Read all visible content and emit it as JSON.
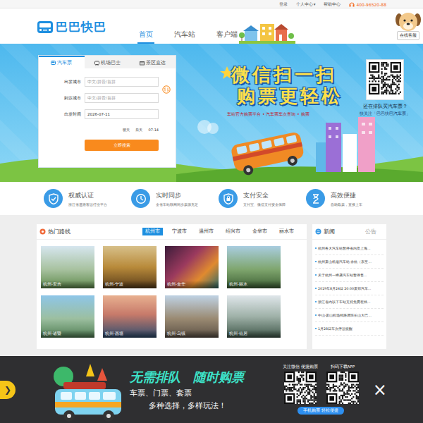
{
  "topbar": {
    "links": [
      {
        "label": "登录"
      },
      {
        "label": "个人中心",
        "caret": "▾"
      },
      {
        "label": "帮助中心"
      }
    ],
    "phone": "400-96520-88"
  },
  "header": {
    "logo": "巴巴快巴",
    "nav": [
      {
        "label": "首页",
        "selected": true
      },
      {
        "label": "汽车站",
        "selected": false
      },
      {
        "label": "客户端",
        "selected": false
      }
    ],
    "service": "在线客服"
  },
  "search": {
    "tabs": [
      {
        "label": "汽车票",
        "selected": true
      },
      {
        "label": "机场巴士",
        "selected": false
      },
      {
        "label": "景区直达",
        "selected": false
      }
    ],
    "fields": [
      {
        "label": "出发城市",
        "placeholder": "中文/拼音/首拼"
      },
      {
        "label": "到达城市",
        "placeholder": "中文/拼音/首拼"
      },
      {
        "label": "出发时间",
        "value": "2026-07-11"
      }
    ],
    "quick_dates": [
      "明天",
      "后天",
      "07-14"
    ],
    "button": "立即搜索"
  },
  "banner": {
    "headline": [
      "微信扫一扫",
      "购票更轻松"
    ],
    "subtitle": "车站官方购票平台 • 汽车票车次查询 • 购票",
    "qr_caption": "还在排队买汽车票？",
    "qr_follow": "快关注「巴巴快巴汽车票」"
  },
  "features": [
    {
      "title": "权威认证",
      "desc": "浙江省道路客运行业平台"
    },
    {
      "title": "实时同步",
      "desc": "全省车站联网同步票源充足"
    },
    {
      "title": "支付安全",
      "desc": "支付宝、微信支付安全保障"
    },
    {
      "title": "高效便捷",
      "desc": "自助取票，直接上车"
    }
  ],
  "routes": {
    "title": "热门路线",
    "cities": [
      {
        "label": "杭州市",
        "selected": true
      },
      {
        "label": "宁波市",
        "selected": false
      },
      {
        "label": "温州市",
        "selected": false
      },
      {
        "label": "绍兴市",
        "selected": false
      },
      {
        "label": "金华市",
        "selected": false
      },
      {
        "label": "丽水市",
        "selected": false
      }
    ],
    "items": [
      {
        "caption": "杭州-安吉"
      },
      {
        "caption": "杭州-宁波"
      },
      {
        "caption": "杭州-金华"
      },
      {
        "caption": "杭州-丽水"
      },
      {
        "caption": "杭州-诸暨"
      },
      {
        "caption": "杭州-西塘"
      },
      {
        "caption": "杭州-乌镇"
      },
      {
        "caption": "杭州-仙居"
      }
    ]
  },
  "news": {
    "tabs": [
      {
        "label": "新闻",
        "selected": true
      },
      {
        "label": "公告",
        "selected": false
      }
    ],
    "items": [
      "杭州各大汽车站暂停省内及上海...",
      "杭州萧山机场汽车站 余杭（东至...",
      "关于杭州—峰晟汽车站暂停售...",
      "2019年8月24日 20:00萧郊汽车...",
      "浙江省内以下车站支持免费在线...",
      "中山·萧山机场线路调班长山大巴...",
      "1月28日车次停运提醒"
    ]
  },
  "popup": {
    "toggle": "❯",
    "headline": [
      "无需排队",
      "随时购票"
    ],
    "lines": [
      "车票、门票、套票",
      "多种选择，多样玩法！"
    ],
    "wechat": "关注微信 便捷购票",
    "app": "扫码下载APP",
    "pill": "手机购票 轻松便捷",
    "close": "×"
  }
}
